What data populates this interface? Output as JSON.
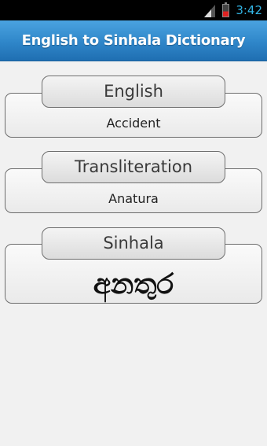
{
  "status_bar": {
    "time": "3:42",
    "icons": [
      "signal-icon",
      "battery-icon"
    ],
    "clock_color": "#33b5e5"
  },
  "app": {
    "title": "English to Sinhala Dictionary",
    "accent_color": "#2f86c9"
  },
  "panels": [
    {
      "label": "English",
      "value": "Accident"
    },
    {
      "label": "Transliteration",
      "value": "Anatura"
    },
    {
      "label": "Sinhala",
      "value": "අනතුර"
    }
  ]
}
